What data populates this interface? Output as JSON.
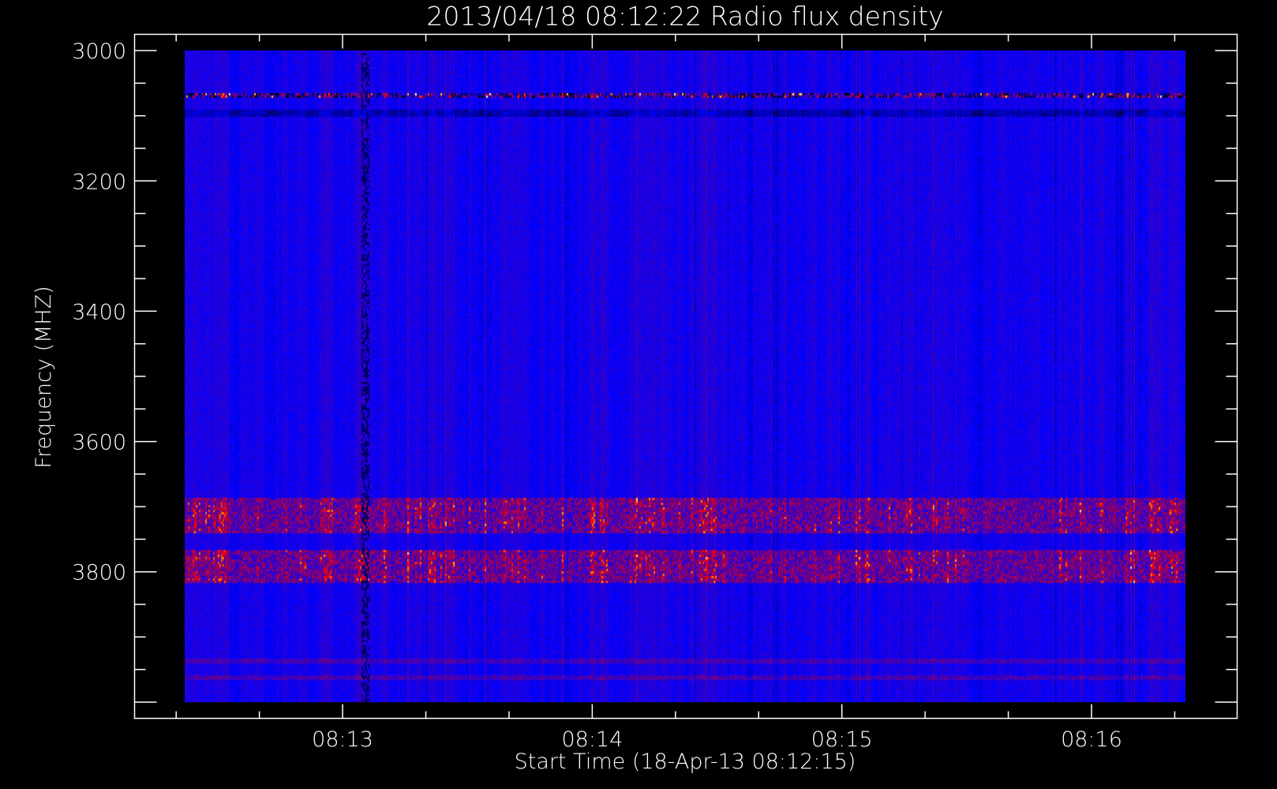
{
  "chart_data": {
    "type": "heatmap",
    "title": "2013/04/18 08:12:22 Radio flux density",
    "xlabel": "Start Time (18-Apr-13 08:12:15)",
    "ylabel": "Frequency (MHZ)",
    "x_axis_range": [
      "08:12:10",
      "08:16:35"
    ],
    "x_data_range": [
      "08:12:22",
      "08:16:22"
    ],
    "x_major_ticks": [
      "08:13",
      "08:14",
      "08:15",
      "08:16"
    ],
    "x_minor_tick_interval_seconds": 20,
    "y_axis_range": [
      2975,
      4025
    ],
    "y_data_range": [
      3000,
      4000
    ],
    "y_inverted": true,
    "y_major_ticks": [
      3000,
      3200,
      3400,
      3600,
      3800
    ],
    "y_minor_tick_interval": 50,
    "colormap": [
      "#000000",
      "#0000ff",
      "#8a0080",
      "#ff0000",
      "#ffff00",
      "#ffffff"
    ],
    "features": [
      {
        "kind": "band",
        "freq_range_mhz": [
          3685,
          3740
        ],
        "level": "high"
      },
      {
        "kind": "band",
        "freq_range_mhz": [
          3765,
          3815
        ],
        "level": "high"
      },
      {
        "kind": "line",
        "freq_mhz": 3070,
        "level": "bursts"
      },
      {
        "kind": "line",
        "freq_mhz": 3960,
        "level": "moderate"
      },
      {
        "kind": "line",
        "freq_mhz": 3935,
        "level": "moderate"
      },
      {
        "kind": "dark_column",
        "time": "08:13:05"
      }
    ]
  }
}
